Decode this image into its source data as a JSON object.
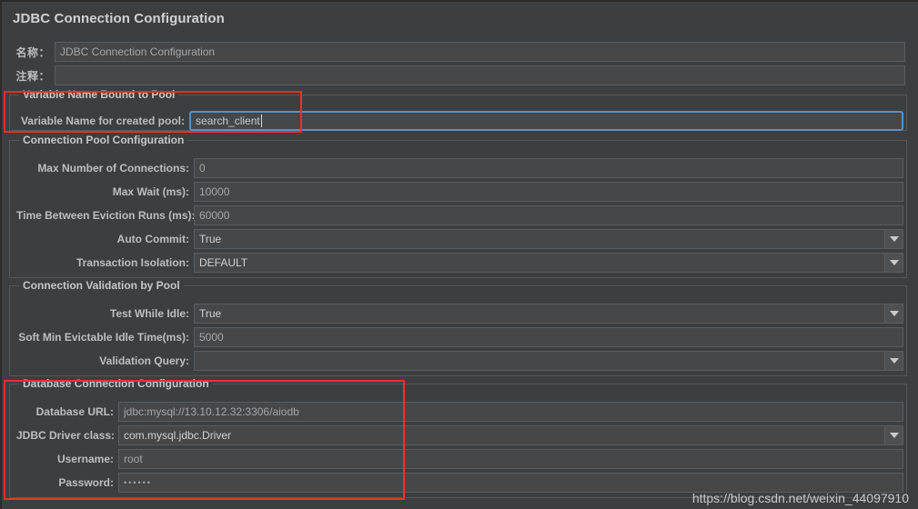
{
  "window": {
    "title": "JDBC Connection Configuration"
  },
  "header_fields": [
    {
      "label": "名称：",
      "value": "JDBC Connection Configuration"
    },
    {
      "label": "注释：",
      "value": ""
    }
  ],
  "groups": {
    "variable_name_bound_to_pool": {
      "title": "Variable Name Bound to Pool",
      "rows": [
        {
          "label": "Variable Name for created pool:",
          "value": "search_client",
          "type": "text-focused"
        }
      ]
    },
    "connection_pool_configuration": {
      "title": "Connection Pool Configuration",
      "rows": [
        {
          "label": "Max Number of Connections:",
          "value": "0",
          "type": "text"
        },
        {
          "label": "Max Wait (ms):",
          "value": "10000",
          "type": "text"
        },
        {
          "label": "Time Between Eviction Runs (ms):",
          "value": "60000",
          "type": "text"
        },
        {
          "label": "Auto Commit:",
          "value": "True",
          "type": "combo"
        },
        {
          "label": "Transaction Isolation:",
          "value": "DEFAULT",
          "type": "combo"
        }
      ]
    },
    "connection_validation_by_pool": {
      "title": "Connection Validation by Pool",
      "rows": [
        {
          "label": "Test While Idle:",
          "value": "True",
          "type": "combo"
        },
        {
          "label": "Soft Min Evictable Idle Time(ms):",
          "value": "5000",
          "type": "text"
        },
        {
          "label": "Validation Query:",
          "value": "",
          "type": "combo"
        }
      ]
    },
    "database_connection_configuration": {
      "title": "Database Connection Configuration",
      "rows": [
        {
          "label": "Database URL:",
          "value": "jdbc:mysql://13.10.12.32:3306/aiodb",
          "type": "text"
        },
        {
          "label": "JDBC Driver class:",
          "value": "com.mysql.jdbc.Driver",
          "type": "combo"
        },
        {
          "label": "Username:",
          "value": "root",
          "type": "text"
        },
        {
          "label": "Password:",
          "value": "••••••",
          "type": "password"
        }
      ]
    }
  },
  "annotations": {
    "highlight_color": "#fc2c25",
    "focus_color": "#5b90c4"
  },
  "watermark": {
    "text": "https://blog.csdn.net/weixin_44097910"
  }
}
